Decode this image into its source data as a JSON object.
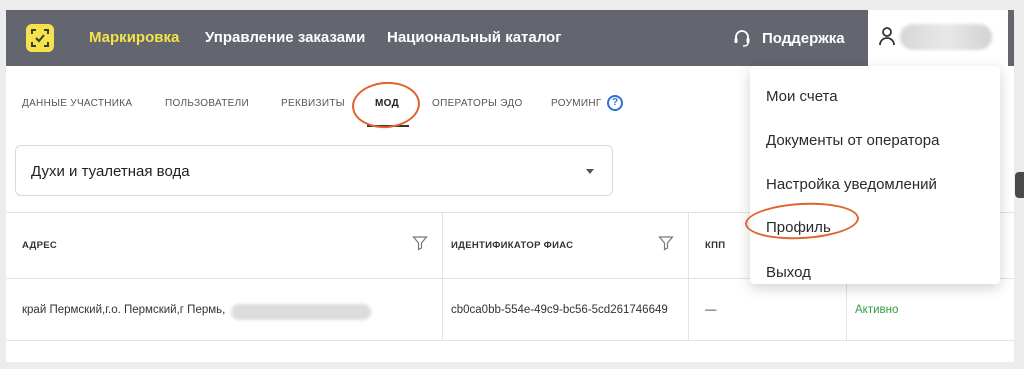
{
  "topbar": {
    "nav": [
      "Маркировка",
      "Управление заказами",
      "Национальный каталог"
    ],
    "support_label": "Поддержка"
  },
  "tabs": [
    "ДАННЫЕ УЧАСТНИКА",
    "ПОЛЬЗОВАТЕЛИ",
    "РЕКВИЗИТЫ",
    "МОД",
    "ОПЕРАТОРЫ ЭДО",
    "РОУМИНГ"
  ],
  "active_tab": "МОД",
  "help_glyph": "?",
  "select": {
    "value": "Духи и туалетная вода"
  },
  "table": {
    "headers": [
      "АДРЕС",
      "ИДЕНТИФИКАТОР ФИАС",
      "КПП"
    ],
    "row": {
      "address": "край Пермский,г.о. Пермский,г Пермь,",
      "fias": "cb0ca0bb-554e-49c9-bc56-5cd261746649",
      "kpp": "—",
      "status": "Активно"
    }
  },
  "dropdown": {
    "items": [
      "Мои счета",
      "Документы от оператора",
      "Настройка уведомлений",
      "Профиль",
      "Выход"
    ]
  },
  "colors": {
    "accent": "#f6e34a",
    "topbar": "#63666f",
    "annotation": "#e0632e",
    "active_status": "#2e9e3f",
    "link": "#2f6fd9"
  }
}
